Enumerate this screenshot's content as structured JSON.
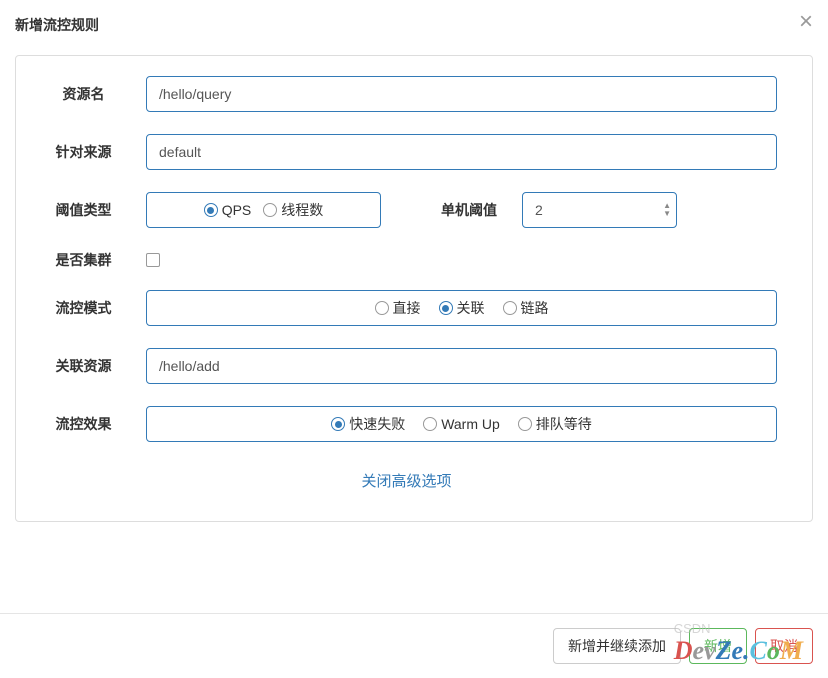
{
  "header": {
    "title": "新增流控规则",
    "close": "×"
  },
  "form": {
    "resourceName": {
      "label": "资源名",
      "value": "/hello/query"
    },
    "limitApp": {
      "label": "针对来源",
      "value": "default"
    },
    "thresholdType": {
      "label": "阈值类型",
      "options": {
        "qps": "QPS",
        "thread": "线程数"
      }
    },
    "threshold": {
      "label": "单机阈值",
      "value": "2"
    },
    "cluster": {
      "label": "是否集群"
    },
    "flowMode": {
      "label": "流控模式",
      "options": {
        "direct": "直接",
        "relate": "关联",
        "chain": "链路"
      }
    },
    "relatedResource": {
      "label": "关联资源",
      "value": "/hello/add"
    },
    "flowEffect": {
      "label": "流控效果",
      "options": {
        "failfast": "快速失败",
        "warmup": "Warm Up",
        "queue": "排队等待"
      }
    },
    "advancedToggle": "关闭高级选项"
  },
  "footer": {
    "addContinue": "新增并继续添加",
    "confirm": "新增",
    "cancel": "取消"
  },
  "watermark": {
    "csdn": "CSDN"
  }
}
